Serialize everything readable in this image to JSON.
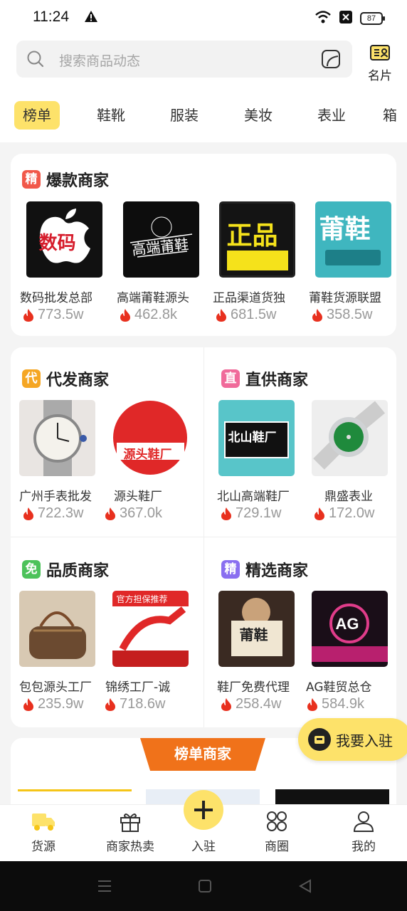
{
  "status": {
    "time": "11:24",
    "battery": "87"
  },
  "search": {
    "placeholder": "搜索商品动态"
  },
  "card_button": {
    "label": "名片"
  },
  "tabs": [
    "榜单",
    "鞋靴",
    "服装",
    "美妆",
    "表业",
    "箱"
  ],
  "hot": {
    "badge": "精",
    "title": "爆款商家",
    "items": [
      {
        "name": "数码批发总部",
        "heat": "773.5w",
        "thumb_text": "数码"
      },
      {
        "name": "高端莆鞋源头",
        "heat": "462.8k",
        "thumb_text": "高端莆鞋"
      },
      {
        "name": "正品渠道货独",
        "heat": "681.5w",
        "thumb_text": "正品"
      },
      {
        "name": "莆鞋货源联盟",
        "heat": "358.5w",
        "thumb_text": "莆鞋"
      }
    ]
  },
  "dropship": {
    "badge": "代",
    "title": "代发商家",
    "items": [
      {
        "name": "广州手表批发",
        "heat": "722.3w"
      },
      {
        "name": "源头鞋厂",
        "heat": "367.0k",
        "thumb_text": "源头鞋厂"
      }
    ]
  },
  "direct": {
    "badge": "直",
    "title": "直供商家",
    "items": [
      {
        "name": "北山高端鞋厂",
        "heat": "729.1w",
        "thumb_text": "北山鞋厂"
      },
      {
        "name": "鼎盛表业",
        "heat": "172.0w"
      }
    ]
  },
  "quality": {
    "badge": "免",
    "title": "品质商家",
    "items": [
      {
        "name": "包包源头工厂",
        "heat": "235.9w"
      },
      {
        "name": "锦绣工厂-诚",
        "heat": "718.6w",
        "thumb_text": "官方担保推荐"
      }
    ]
  },
  "selected": {
    "badge": "精",
    "title": "精选商家",
    "items": [
      {
        "name": "鞋厂免费代理",
        "heat": "258.4w",
        "thumb_text": "莆鞋"
      },
      {
        "name": "AG鞋贸总仓",
        "heat": "584.9k",
        "thumb_text": "AG"
      }
    ]
  },
  "join_button": {
    "label": "我要入驻"
  },
  "rank_banner": {
    "title": "榜单商家"
  },
  "bottom_nav": {
    "items": [
      "货源",
      "商家热卖",
      "入驻",
      "商圈",
      "我的"
    ]
  },
  "colors": {
    "accent": "#fde26a",
    "heat": "#e8301e",
    "banner": "#f0721a"
  }
}
